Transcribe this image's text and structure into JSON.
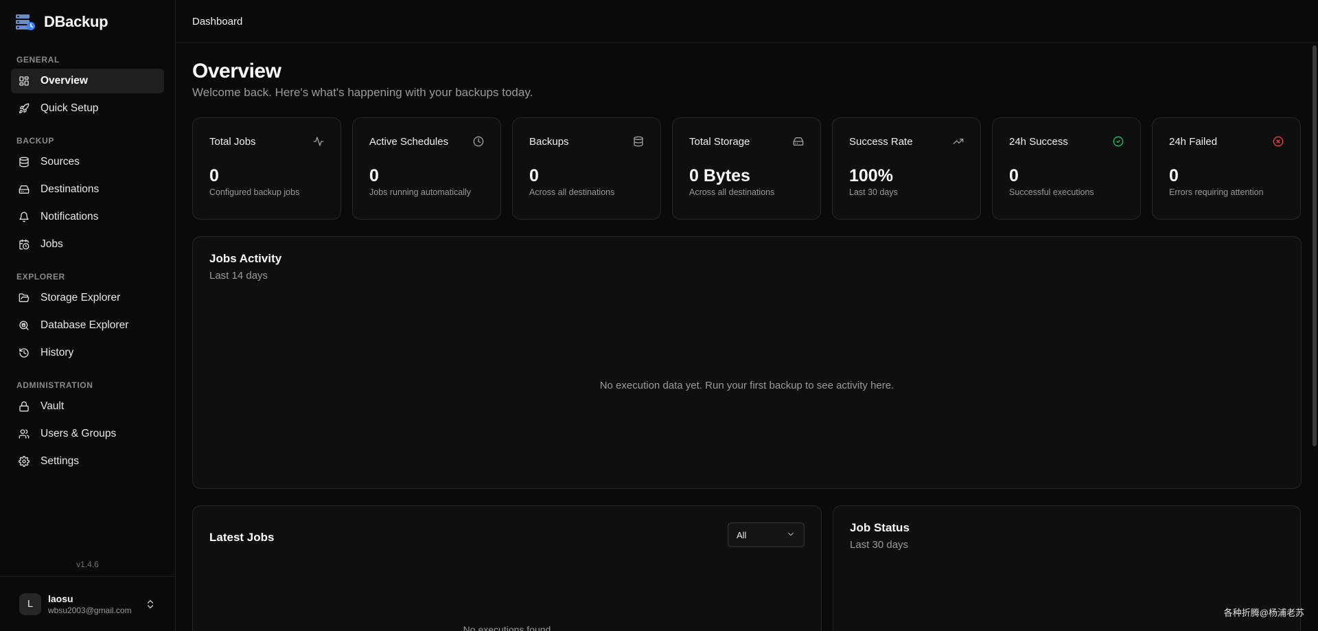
{
  "brand": {
    "name": "DBackup"
  },
  "sidebar": {
    "groups": [
      {
        "label": "GENERAL",
        "items": [
          {
            "label": "Overview",
            "icon": "layout-dashboard-icon",
            "active": true
          },
          {
            "label": "Quick Setup",
            "icon": "rocket-icon"
          }
        ]
      },
      {
        "label": "BACKUP",
        "items": [
          {
            "label": "Sources",
            "icon": "database-icon"
          },
          {
            "label": "Destinations",
            "icon": "hard-drive-icon"
          },
          {
            "label": "Notifications",
            "icon": "bell-icon"
          },
          {
            "label": "Jobs",
            "icon": "calendar-clock-icon"
          }
        ]
      },
      {
        "label": "EXPLORER",
        "items": [
          {
            "label": "Storage Explorer",
            "icon": "folder-open-icon"
          },
          {
            "label": "Database Explorer",
            "icon": "database-search-icon"
          },
          {
            "label": "History",
            "icon": "history-icon"
          }
        ]
      },
      {
        "label": "ADMINISTRATION",
        "items": [
          {
            "label": "Vault",
            "icon": "lock-icon"
          },
          {
            "label": "Users & Groups",
            "icon": "users-icon"
          },
          {
            "label": "Settings",
            "icon": "settings-icon"
          }
        ]
      }
    ],
    "version": "v1.4.6"
  },
  "user": {
    "initial": "L",
    "name": "laosu",
    "email": "wbsu2003@gmail.com"
  },
  "header": {
    "breadcrumb": "Dashboard"
  },
  "page": {
    "title": "Overview",
    "subtitle": "Welcome back. Here's what's happening with your backups today."
  },
  "stats": [
    {
      "label": "Total Jobs",
      "value": "0",
      "desc": "Configured backup jobs",
      "icon": "activity-icon",
      "icon_color": "#a0a0a0"
    },
    {
      "label": "Active Schedules",
      "value": "0",
      "desc": "Jobs running automatically",
      "icon": "clock-icon",
      "icon_color": "#a0a0a0"
    },
    {
      "label": "Backups",
      "value": "0",
      "desc": "Across all destinations",
      "icon": "database-icon",
      "icon_color": "#a0a0a0"
    },
    {
      "label": "Total Storage",
      "value": "0 Bytes",
      "desc": "Across all destinations",
      "icon": "hard-drive-icon",
      "icon_color": "#a0a0a0"
    },
    {
      "label": "Success Rate",
      "value": "100%",
      "desc": "Last 30 days",
      "icon": "trending-up-icon",
      "icon_color": "#a0a0a0"
    },
    {
      "label": "24h Success",
      "value": "0",
      "desc": "Successful executions",
      "icon": "check-circle-icon",
      "icon_color": "#22c55e"
    },
    {
      "label": "24h Failed",
      "value": "0",
      "desc": "Errors requiring attention",
      "icon": "x-circle-icon",
      "icon_color": "#ef4444"
    }
  ],
  "activity": {
    "title": "Jobs Activity",
    "subtitle": "Last 14 days",
    "empty": "No execution data yet. Run your first backup to see activity here."
  },
  "latest": {
    "title": "Latest Jobs",
    "filter": "All",
    "empty": "No executions found"
  },
  "status": {
    "title": "Job Status",
    "subtitle": "Last 30 days"
  },
  "watermark": "各种折腾@杨浦老苏"
}
